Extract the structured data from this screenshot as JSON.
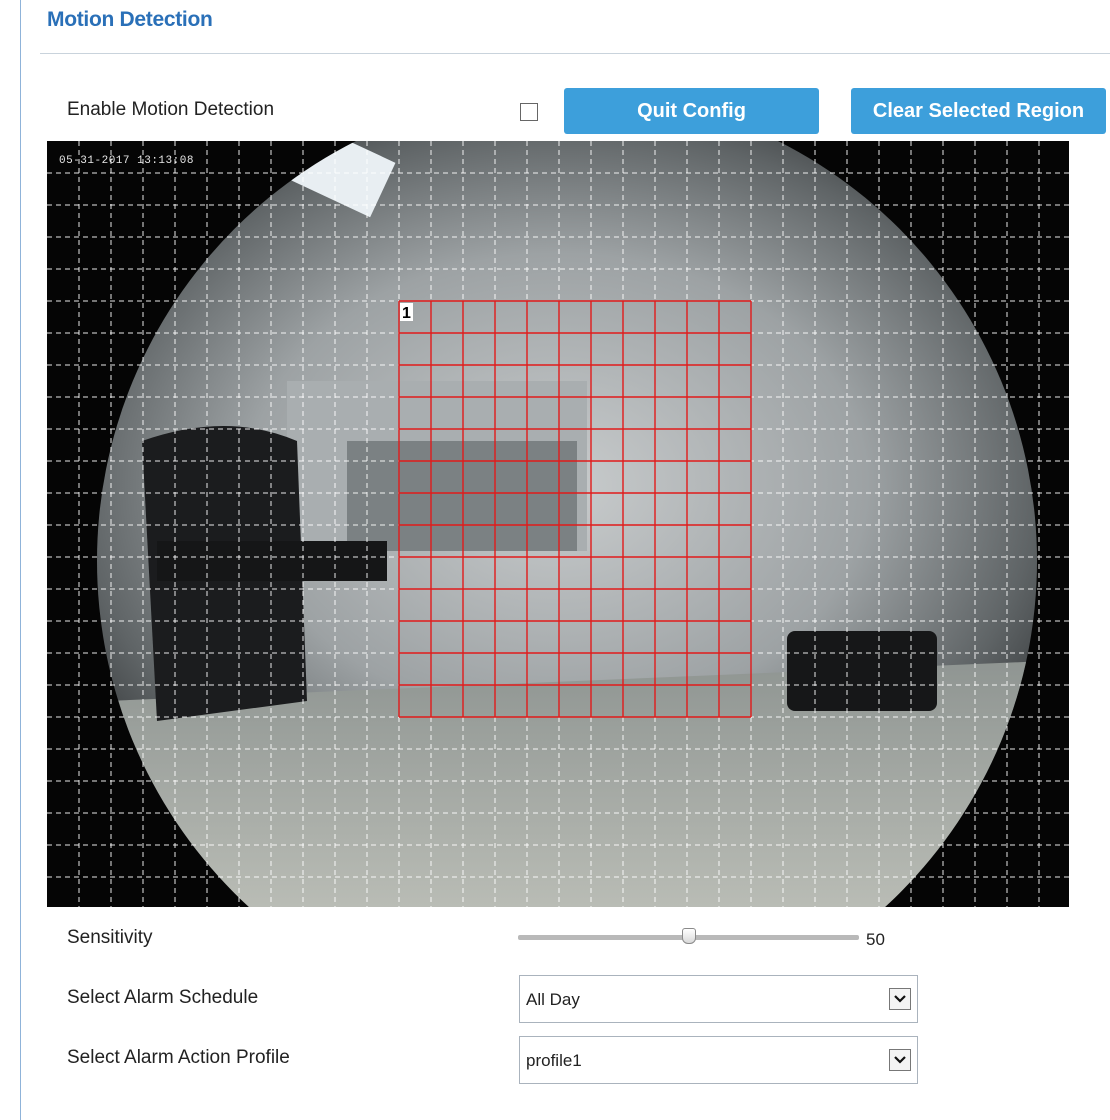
{
  "page": {
    "title": "Motion Detection"
  },
  "enable": {
    "label": "Enable Motion Detection",
    "checked": false
  },
  "buttons": {
    "quit_config": "Quit Config",
    "clear_region": "Clear Selected Region"
  },
  "video": {
    "timestamp": "05-31-2017 13:13:08",
    "region": {
      "label": "1",
      "color": "#e11b1b"
    },
    "grid_color": "#ffffff"
  },
  "sensitivity": {
    "label": "Sensitivity",
    "value": "50",
    "fraction": 0.5
  },
  "schedule": {
    "label": "Select Alarm Schedule",
    "value": "All Day"
  },
  "action_profile": {
    "label": "Select Alarm Action Profile",
    "value": "profile1"
  },
  "colors": {
    "accent": "#3d9fdb",
    "title": "#2a70b8"
  }
}
